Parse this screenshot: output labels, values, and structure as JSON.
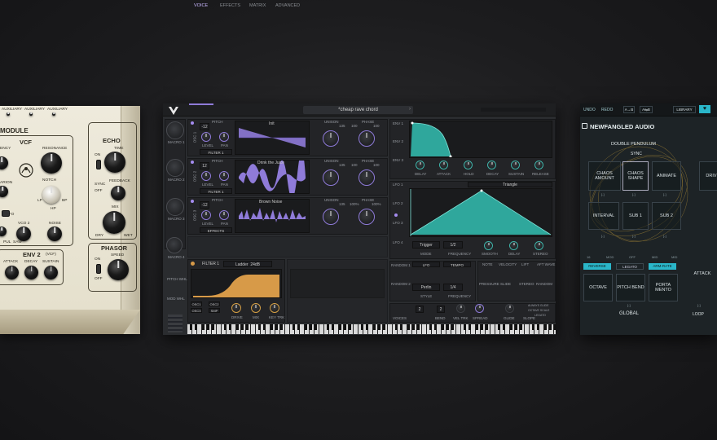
{
  "left_module": {
    "top_labels": [
      "AUXILIARY",
      "AUXILIARY",
      "AUXILIARY"
    ],
    "title": "MODULE",
    "vcf": {
      "title": "VCF",
      "resonance": "RESONANCE",
      "notch": "NOTCH",
      "lp": "LP",
      "bp": "BP",
      "hp": "HP",
      "freq_prefix": "ENCY",
      "env_prefix": "ARION"
    },
    "lfo": "LFO",
    "vco2": "VCO 2",
    "noise": "NOISE",
    "pul": "PUL",
    "saw": "SAW",
    "env2": {
      "title": "ENV 2",
      "sub": "(VCF)",
      "attack": "ATTACK",
      "decay": "DECAY",
      "sustain": "SUSTAIN"
    },
    "echo": {
      "title": "ECHO",
      "time": "TIME",
      "sync": "SYNC",
      "feedback": "FEEDBACK",
      "on": "ON",
      "off": "OFF",
      "mix": "MIX",
      "dry": "DRY",
      "wet": "WET"
    },
    "phasor": {
      "title": "PHASOR",
      "speed": "SPEED",
      "on": "ON",
      "off": "OFF"
    }
  },
  "vital": {
    "tabs": [
      "VOICE",
      "EFFECTS",
      "MATRIX",
      "ADVANCED"
    ],
    "active_tab": "VOICE",
    "preset_name": "*cheap rave chord",
    "macros": [
      "MACRO 1",
      "MACRO 2",
      "MACRO 3",
      "MACRO 4"
    ],
    "oscillators": [
      {
        "label": "OSC 1",
        "pitch": "PITCH",
        "unison": "UNISON",
        "phase": "PHASE",
        "semi": "-12",
        "wave_name": "Init",
        "filter": "FILTER 1",
        "level": "LEVEL",
        "pan": "PAN",
        "voices": "135",
        "detune": "100",
        "phase_val": "100"
      },
      {
        "label": "OSC 2",
        "pitch": "PITCH",
        "unison": "UNISON",
        "phase": "PHASE",
        "semi": "12",
        "wave_name": "Drink the Juice",
        "filter": "FILTER 1",
        "level": "LEVEL",
        "pan": "PAN",
        "voices": "135",
        "detune": "100",
        "phase_val": "100"
      },
      {
        "label": "OSC 3",
        "pitch": "PITCH",
        "unison": "UNISON",
        "phase": "PHASE",
        "semi": "-12",
        "wave_name": "Brown Noise",
        "filter": "EFFECTS",
        "level": "LEVEL",
        "pan": "PAN",
        "voices": "135",
        "detune": "100%",
        "phase_val": "100%"
      }
    ],
    "envs": [
      "ENV 1",
      "ENV 2",
      "ENV 3"
    ],
    "env_controls": [
      "DELAY",
      "ATTACK",
      "HOLD",
      "DECAY",
      "SUSTAIN",
      "RELEASE"
    ],
    "lfos": [
      "LFO 1",
      "LFO 2",
      "LFO 3",
      "LFO 4"
    ],
    "lfo_shape": "Triangle",
    "lfo_controls": {
      "mode_value": "Trigger",
      "mode": "MODE",
      "freq_value": "1/2",
      "frequency": "FREQUENCY",
      "smooth": "SMOOTH",
      "delay": "DELAY",
      "stereo": "STEREO"
    },
    "left_mod": [
      "PITCH WHL",
      "MOD WHL"
    ],
    "filter": {
      "name": "FILTER 1",
      "type": "Ladder",
      "slope": "24dB",
      "buttons": [
        "OSC1",
        "OSC2",
        "OSC3",
        "SMP"
      ],
      "controls": [
        "DRIVE",
        "MIX",
        "KEY TRK"
      ]
    },
    "random": [
      "RANDOM 1",
      "RANDOM 2"
    ],
    "random_controls": {
      "style": "STYLE",
      "frequency": "FREQUENCY",
      "tab1": "LFO",
      "tab2": "TEMPO",
      "perlin": "Perlin",
      "freq_value": "1/4"
    },
    "mod_sources": [
      "NOTE",
      "VELOCITY",
      "LIFT",
      "AFT WAVE",
      "PRESSURE",
      "SLIDE",
      "STEREO",
      "RANDOM"
    ],
    "voice_bottom": [
      "VOICES",
      "BEND",
      "VEL TRK",
      "SPREAD",
      "GLIDE",
      "SLOPE"
    ],
    "voice_values": [
      "2",
      "2"
    ],
    "legato_labels": [
      "ALWAYS GLIDE",
      "OCTAVE SCALE",
      "LEGATO"
    ]
  },
  "newfangled": {
    "toolbar": [
      "UNDO",
      "REDO",
      "A→B",
      "A⇆B",
      "LIBRARY"
    ],
    "brand": "NEWFANGLED AUDIO",
    "mode": "DOUBLE PENDULUM",
    "sync": "SYNC",
    "chaos": [
      "CHAOS AMOUNT",
      "CHAOS SHAPE",
      "ANIMATE",
      "DRIV"
    ],
    "interval_row": [
      "INTERVAL",
      "SUB 1",
      "SUB 2"
    ],
    "keyb": [
      "16",
      "MOD",
      "OFF",
      "MID",
      "MID"
    ],
    "selectors": [
      "REVERSE",
      "LEGATO",
      "ARM-RATE"
    ],
    "global_buttons": [
      "OCTAVE",
      "PITCH BEND",
      "PORTA MENTO",
      "ATTACK"
    ],
    "global": "GLOBAL",
    "loop": "LOOP",
    "heart": "♥"
  },
  "colors": {
    "vital_purple": "#8f7bd9",
    "vital_teal": "#2fa79c",
    "vital_orange": "#d79a48",
    "nf_cyan": "#2ab6c9",
    "cream": "#ebe6d4",
    "nf_gold": "#c9a03a"
  }
}
